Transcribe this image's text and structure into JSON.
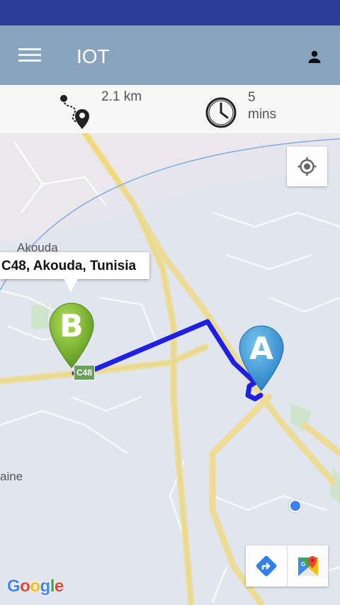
{
  "app_bar": {
    "title": "IOT",
    "menu_icon": "hamburger-menu-icon",
    "account_icon": "person-icon",
    "color": "#8aa4be"
  },
  "status_bar": {
    "color": "#2f3d9a"
  },
  "route_summary": {
    "distance": "2.1 km",
    "duration": "5\nmins",
    "distance_icon": "route-icon",
    "duration_icon": "clock-icon"
  },
  "map": {
    "info_window_text": "C48, Akouda, Tunisia",
    "place_label_akouda": "Akouda",
    "place_label_partial": "aine",
    "road_shield": "C48",
    "marker_a_label": "A",
    "marker_b_label": "B",
    "route_color": "#1f1fe6",
    "attribution": "Google",
    "locate_icon": "my-location-icon",
    "directions_icon": "directions-icon",
    "maps_icon": "google-maps-icon"
  }
}
